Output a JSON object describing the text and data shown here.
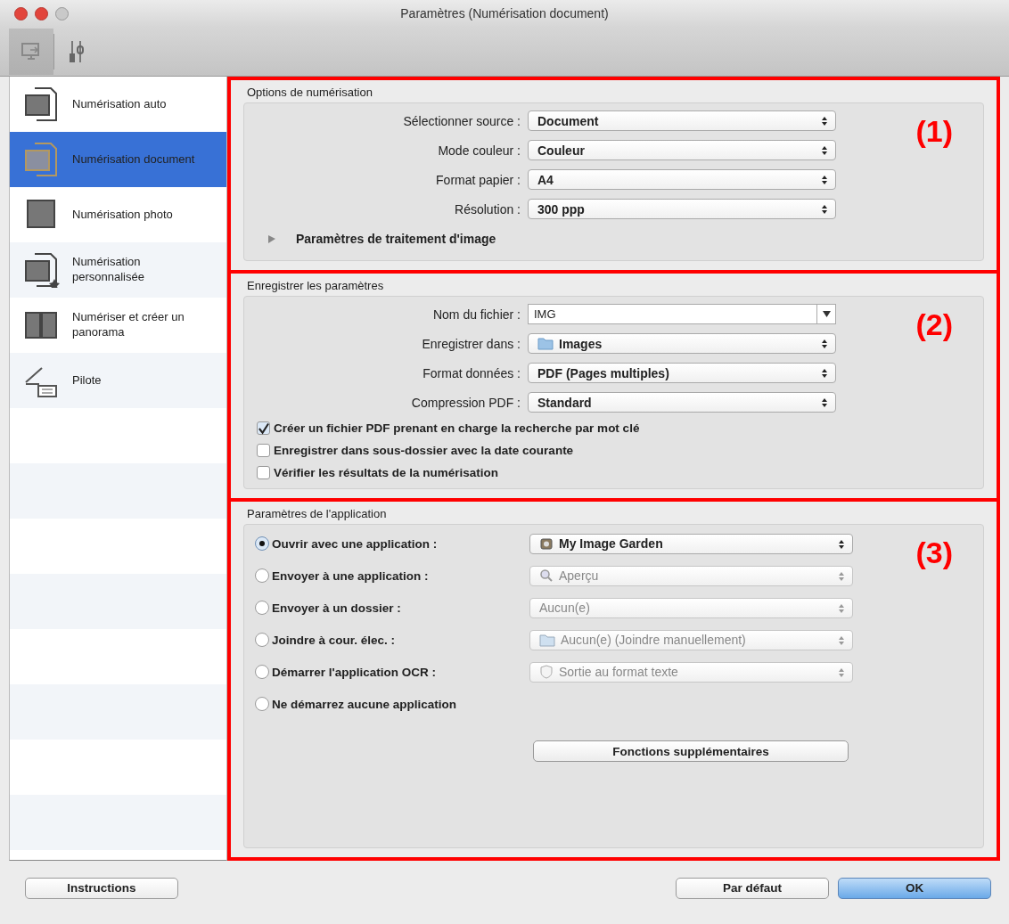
{
  "window": {
    "title": "Paramètres (Numérisation document)"
  },
  "toolbar": {
    "items": [
      {
        "selected": true
      },
      {
        "selected": false
      }
    ]
  },
  "sidebar": {
    "items": [
      {
        "label": "Numérisation auto",
        "selected": false
      },
      {
        "label": "Numérisation document",
        "selected": true
      },
      {
        "label": "Numérisation photo",
        "selected": false
      },
      {
        "label": "Numérisation personnalisée",
        "selected": false
      },
      {
        "label": "Numériser et créer un panorama",
        "selected": false
      },
      {
        "label": "Pilote",
        "selected": false
      }
    ]
  },
  "sections": [
    {
      "title": "Options de numérisation",
      "callout": "(1)",
      "items": [
        {
          "kind": "select",
          "label": "Sélectionner source :",
          "value": "Document",
          "disabled": false
        },
        {
          "kind": "select",
          "label": "Mode couleur :",
          "value": "Couleur",
          "disabled": false
        },
        {
          "kind": "select",
          "label": "Format papier :",
          "value": "A4",
          "disabled": false
        },
        {
          "kind": "select",
          "label": "Résolution :",
          "value": "300 ppp",
          "disabled": false
        },
        {
          "kind": "disclosure",
          "label": "Paramètres de traitement d'image",
          "expanded": false
        }
      ]
    },
    {
      "title": "Enregistrer les paramètres",
      "callout": "(2)",
      "items": [
        {
          "kind": "combo",
          "label": "Nom du fichier :",
          "value": "IMG"
        },
        {
          "kind": "select",
          "label": "Enregistrer dans :",
          "value": "Images",
          "disabled": false
        },
        {
          "kind": "select",
          "label": "Format données :",
          "value": "PDF (Pages multiples)",
          "disabled": false
        },
        {
          "kind": "select",
          "label": "Compression PDF :",
          "value": "Standard",
          "disabled": false
        },
        {
          "kind": "checkbox",
          "label": "Créer un fichier PDF prenant en charge la recherche par mot clé",
          "checked": true
        },
        {
          "kind": "checkbox",
          "label": "Enregistrer dans sous-dossier avec la date courante",
          "checked": false
        },
        {
          "kind": "checkbox",
          "label": "Vérifier les résultats de la numérisation",
          "checked": false
        }
      ]
    },
    {
      "title": "Paramètres de l'application",
      "callout": "(3)",
      "items": [
        {
          "kind": "radio",
          "label": "Ouvrir avec une application :",
          "selected": true,
          "value": "My Image Garden",
          "disabled": false
        },
        {
          "kind": "radio",
          "label": "Envoyer à une application :",
          "selected": false,
          "value": "Aperçu",
          "disabled": true
        },
        {
          "kind": "radio",
          "label": "Envoyer à un dossier :",
          "selected": false,
          "value": "Aucun(e)",
          "disabled": true
        },
        {
          "kind": "radio",
          "label": "Joindre à cour. élec. :",
          "selected": false,
          "value": "Aucun(e) (Joindre manuellement)",
          "disabled": true
        },
        {
          "kind": "radio",
          "label": "Démarrer l'application OCR :",
          "selected": false,
          "value": "Sortie au format texte",
          "disabled": true
        },
        {
          "kind": "radio",
          "label": "Ne démarrez aucune application",
          "selected": false
        },
        {
          "kind": "button",
          "label": "Fonctions supplémentaires"
        }
      ]
    }
  ],
  "footer": {
    "left": [
      {
        "label": "Instructions",
        "default": false
      }
    ],
    "right": [
      {
        "label": "Par défaut",
        "default": false
      },
      {
        "label": "OK",
        "default": true
      }
    ]
  }
}
